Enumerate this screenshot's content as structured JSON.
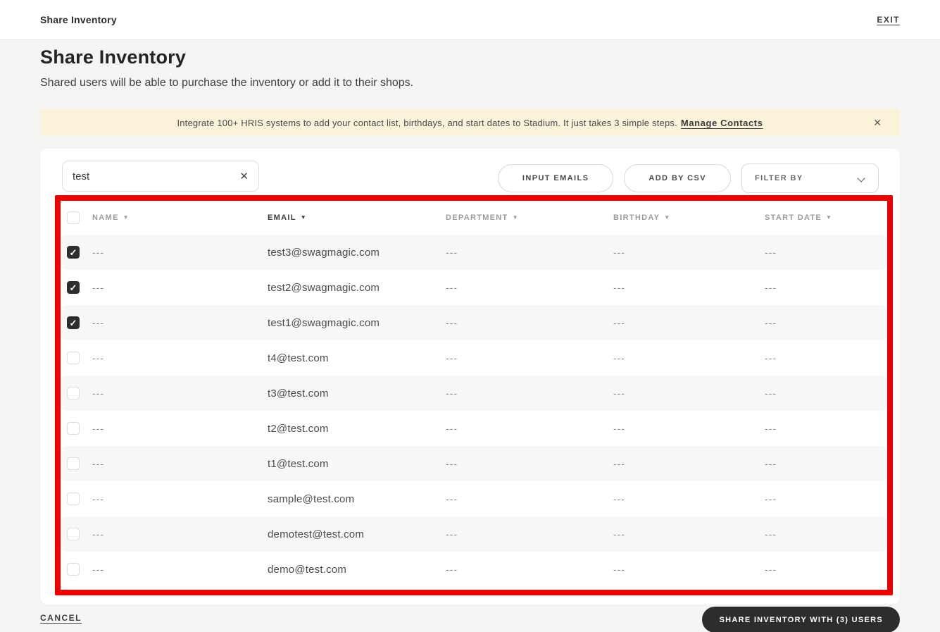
{
  "topbar": {
    "title": "Share Inventory",
    "exit_label": "EXIT"
  },
  "header": {
    "title": "Share Inventory",
    "subtitle": "Shared users will be able to purchase the inventory or add it to their shops."
  },
  "banner": {
    "text": "Integrate 100+ HRIS systems to add your contact list, birthdays, and start dates to Stadium. It just takes 3 simple steps.",
    "link_label": "Manage Contacts",
    "close_icon": "✕",
    "background_color": "#faf3da"
  },
  "toolbar": {
    "search_value": "test",
    "clear_icon": "✕",
    "input_emails_label": "INPUT EMAILS",
    "add_by_csv_label": "ADD BY CSV",
    "filter_by_label": "FILTER BY"
  },
  "table": {
    "columns": [
      {
        "label": "NAME",
        "sorted": false
      },
      {
        "label": "EMAIL",
        "sorted": true
      },
      {
        "label": "DEPARTMENT",
        "sorted": false
      },
      {
        "label": "BIRTHDAY",
        "sorted": false
      },
      {
        "label": "START DATE",
        "sorted": false
      }
    ],
    "sort_arrow_icon": "▼",
    "rows": [
      {
        "checked": true,
        "name": "---",
        "email": "test3@swagmagic.com",
        "department": "---",
        "birthday": "---",
        "start_date": "---"
      },
      {
        "checked": true,
        "name": "---",
        "email": "test2@swagmagic.com",
        "department": "---",
        "birthday": "---",
        "start_date": "---"
      },
      {
        "checked": true,
        "name": "---",
        "email": "test1@swagmagic.com",
        "department": "---",
        "birthday": "---",
        "start_date": "---"
      },
      {
        "checked": false,
        "name": "---",
        "email": "t4@test.com",
        "department": "---",
        "birthday": "---",
        "start_date": "---"
      },
      {
        "checked": false,
        "name": "---",
        "email": "t3@test.com",
        "department": "---",
        "birthday": "---",
        "start_date": "---"
      },
      {
        "checked": false,
        "name": "---",
        "email": "t2@test.com",
        "department": "---",
        "birthday": "---",
        "start_date": "---"
      },
      {
        "checked": false,
        "name": "---",
        "email": "t1@test.com",
        "department": "---",
        "birthday": "---",
        "start_date": "---"
      },
      {
        "checked": false,
        "name": "---",
        "email": "sample@test.com",
        "department": "---",
        "birthday": "---",
        "start_date": "---"
      },
      {
        "checked": false,
        "name": "---",
        "email": "demotest@test.com",
        "department": "---",
        "birthday": "---",
        "start_date": "---"
      },
      {
        "checked": false,
        "name": "---",
        "email": "demo@test.com",
        "department": "---",
        "birthday": "---",
        "start_date": "---"
      }
    ],
    "selected_count": 3
  },
  "footer": {
    "cancel_label": "CANCEL",
    "share_label": "SHARE INVENTORY WITH (3) USERS",
    "share_button_color": "#2d2d2d"
  },
  "annotation": {
    "highlight_color": "#ec0000"
  }
}
